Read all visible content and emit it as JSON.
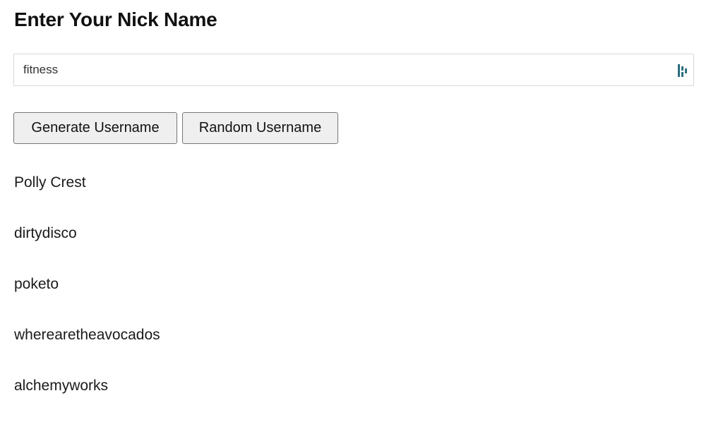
{
  "page": {
    "title": "Enter Your Nick Name"
  },
  "nickname_input": {
    "value": "fitness",
    "placeholder": ""
  },
  "buttons": {
    "generate_label": "Generate Username",
    "random_label": "Random Username"
  },
  "results": [
    "Polly Crest",
    "dirtydisco",
    "poketo",
    "wherearetheavocados",
    "alchemyworks"
  ],
  "icons": {
    "input_extension_icon": "password-manager-icon"
  },
  "colors": {
    "button_bg": "#efefef",
    "button_border": "#767676",
    "input_border": "#d8d8d8",
    "icon_color": "#2c6e7f"
  }
}
